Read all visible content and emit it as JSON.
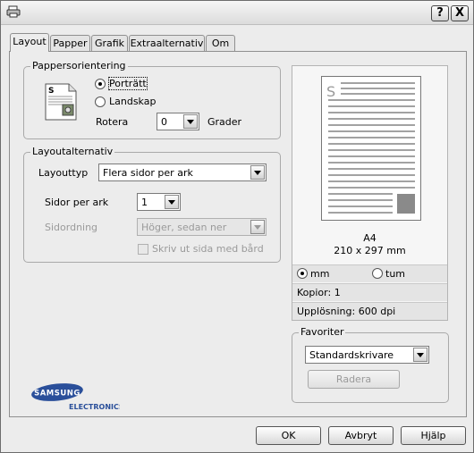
{
  "titlebar": {
    "help_button": "?",
    "close_button": "X"
  },
  "tabs": [
    "Layout",
    "Papper",
    "Grafik",
    "Extraalternativ",
    "Om"
  ],
  "orientation": {
    "group_title": "Pappersorientering",
    "portrait_label": "Porträtt",
    "landscape_label": "Landskap",
    "rotate_label": "Rotera",
    "rotate_value": "0",
    "rotate_unit": "Grader",
    "selected": "portrait"
  },
  "layout_options": {
    "group_title": "Layoutalternativ",
    "layout_type_label": "Layouttyp",
    "layout_type_value": "Flera sidor per ark",
    "pages_per_sheet_label": "Sidor per ark",
    "pages_per_sheet_value": "1",
    "page_order_label": "Sidordning",
    "page_order_value": "Höger, sedan ner",
    "print_border_label": "Skriv ut sida med bård"
  },
  "preview": {
    "page_letter": "S",
    "paper_name": "A4",
    "paper_size": "210 x 297 mm",
    "unit_mm": "mm",
    "unit_inch": "tum",
    "selected_unit": "mm",
    "copies": "Kopior: 1",
    "resolution": "Upplösning: 600 dpi"
  },
  "favorites": {
    "group_title": "Favoriter",
    "selected_value": "Standardskrivare",
    "delete_button": "Radera"
  },
  "logo": {
    "brand": "SAMSUNG",
    "sub": "ELECTRONICS"
  },
  "buttons": {
    "ok": "OK",
    "cancel": "Avbryt",
    "help": "Hjälp"
  },
  "colors": {
    "dialog_bg": "#ececec",
    "logo_blue": "#2a4f9a"
  }
}
